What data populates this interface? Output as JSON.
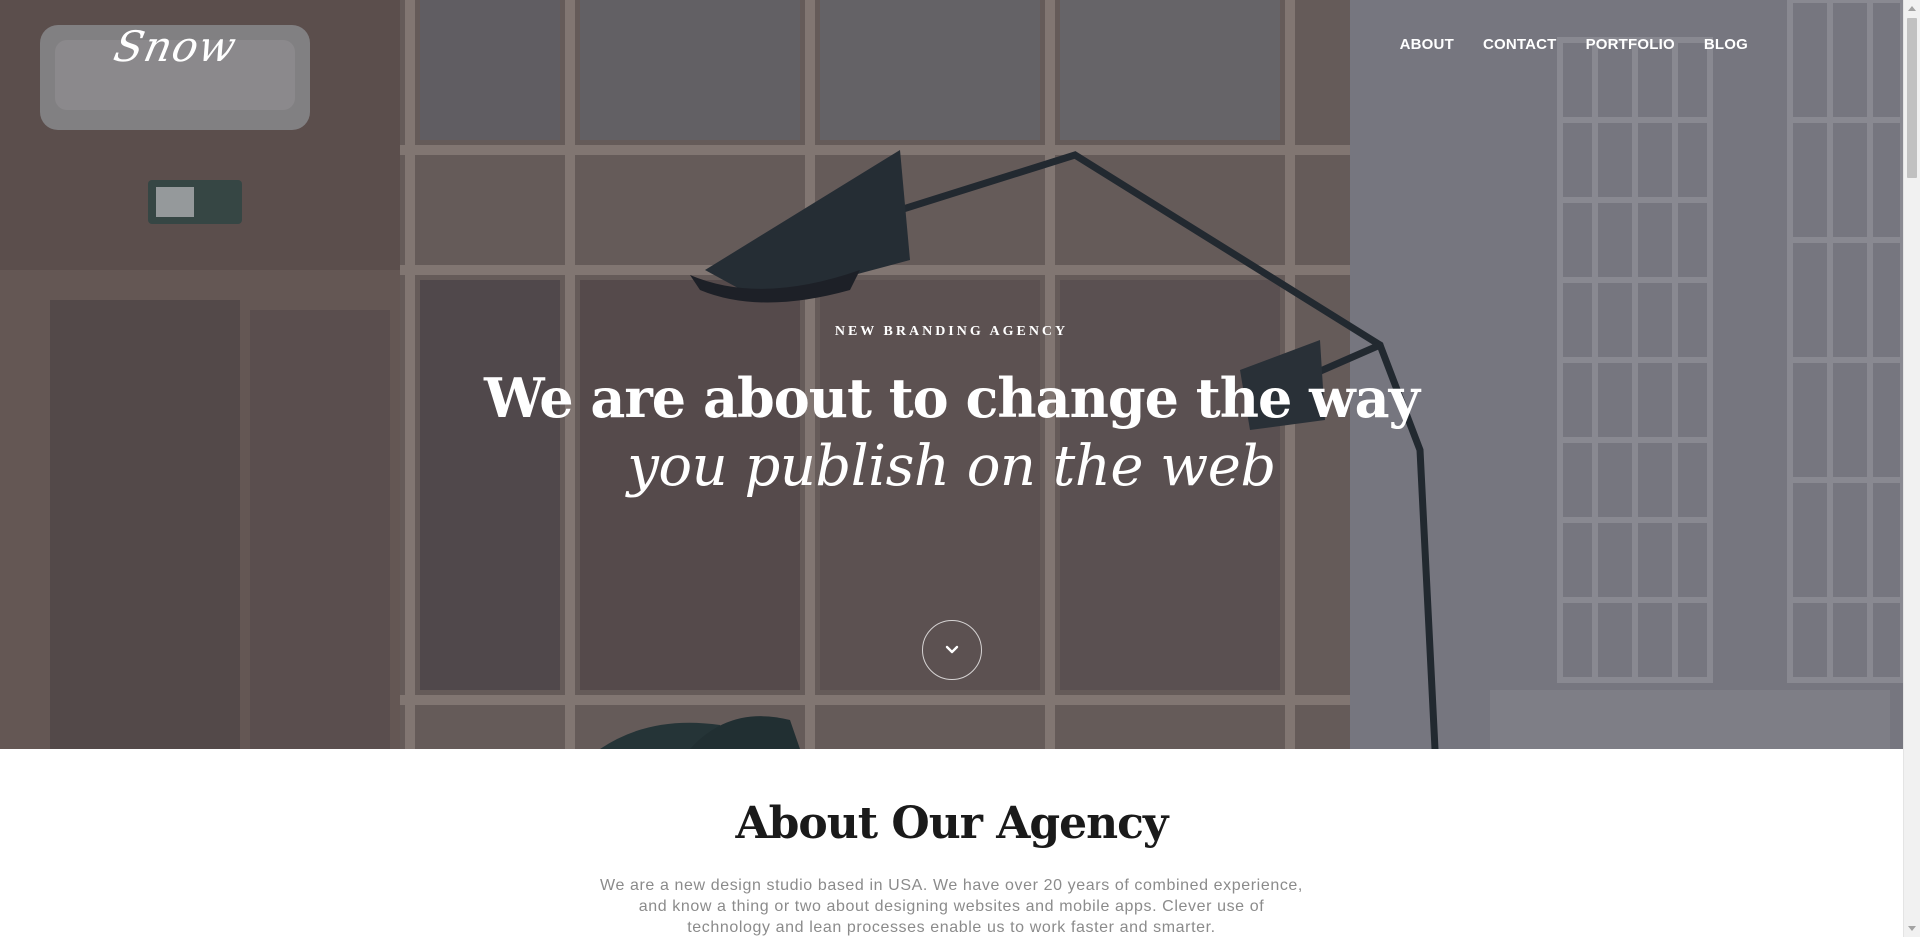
{
  "header": {
    "logo": "Snow",
    "nav": [
      {
        "label": "ABOUT"
      },
      {
        "label": "CONTACT"
      },
      {
        "label": "PORTFOLIO"
      },
      {
        "label": "BLOG"
      }
    ]
  },
  "hero": {
    "eyebrow": "NEW BRANDING AGENCY",
    "headline": "We are about to change the way",
    "subheadline": "you publish on the web",
    "scroll_icon": "chevron-down-icon"
  },
  "about": {
    "title": "About Our Agency",
    "text_lines": [
      "We are a new design studio based in USA. We have over 20 years of combined experience,",
      "and know a thing or two about designing websites and mobile apps. Clever use of",
      "technology and lean processes enable us to work faster and smarter."
    ]
  },
  "colors": {
    "hero_overlay": "#2d2d3a",
    "text_light": "#ffffff",
    "heading_dark": "#1a1a1a",
    "body_gray": "#8b8b8b"
  }
}
